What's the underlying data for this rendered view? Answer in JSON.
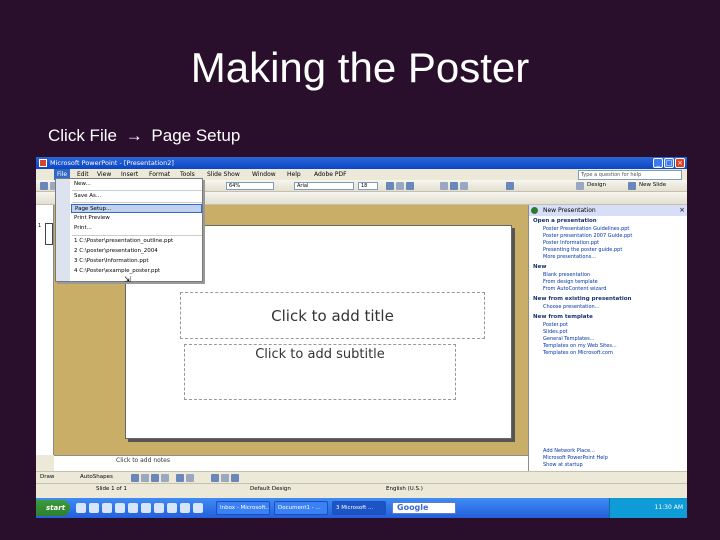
{
  "slide": {
    "title": "Making the Poster",
    "subtitle_pre": "Click File",
    "subtitle_arrow": "→",
    "subtitle_post": "Page Setup"
  },
  "window": {
    "title": "Microsoft PowerPoint - [Presentation2]",
    "min": "_",
    "max": "□",
    "close": "×"
  },
  "menubar": {
    "items": [
      "File",
      "Edit",
      "View",
      "Insert",
      "Format",
      "Tools",
      "Slide Show",
      "Window",
      "Help",
      "Adobe PDF"
    ],
    "help_placeholder": "Type a question for help"
  },
  "toolbar": {
    "font_name": "Arial",
    "font_size": "18",
    "zoom": "64%",
    "design_label": "Design",
    "new_slide_label": "New Slide"
  },
  "file_menu": {
    "items": [
      "New...",
      "Save As...",
      "Page Setup...",
      "Print Preview",
      "Print...",
      "1 C:\\Poster\\presentation_outline.ppt",
      "2 C:\\poster\\presentation_2004",
      "3 C:\\Poster\\Information.ppt",
      "4 C:\\Poster\\example_poster.ppt"
    ],
    "highlighted_index": 2
  },
  "slide_canvas": {
    "title_placeholder": "Click to add title",
    "subtitle_placeholder": "Click to add subtitle"
  },
  "notes": {
    "placeholder": "Click to add notes"
  },
  "slides_pane": {
    "slide_number": "1"
  },
  "task_pane": {
    "header": "New Presentation",
    "sections": [
      {
        "title": "Open a presentation",
        "links": [
          "Poster Presentation Guidelines.ppt",
          "Poster presentation 2007 Guide.ppt",
          "Poster Information.ppt",
          "Presenting the poster guide.ppt",
          "More presentations..."
        ]
      },
      {
        "title": "New",
        "links": [
          "Blank presentation",
          "From design template",
          "From AutoContent wizard"
        ]
      },
      {
        "title": "New from existing presentation",
        "links": [
          "Choose presentation..."
        ]
      },
      {
        "title": "New from template",
        "links": [
          "Poster.pot",
          "Slides.pot",
          "General Templates...",
          "Templates on my Web Sites...",
          "Templates on Microsoft.com"
        ]
      }
    ],
    "bottom_links": [
      "Add Network Place...",
      "Microsoft PowerPoint Help",
      "Show at startup"
    ]
  },
  "drawbar": {
    "draw_label": "Draw",
    "autoshapes_label": "AutoShapes"
  },
  "statusbar": {
    "slide_info": "Slide 1 of 1",
    "design": "Default Design",
    "language": "English (U.S.)"
  },
  "taskbar": {
    "start": "start",
    "buttons": [
      "Inbox - Microsoft...",
      "Document1 - ...",
      "3 Microsoft ..."
    ],
    "search_text": "Google",
    "clock": "11:30 AM"
  }
}
